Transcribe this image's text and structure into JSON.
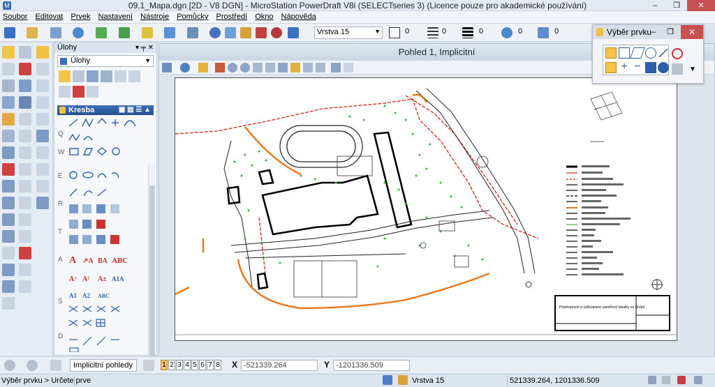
{
  "window": {
    "title": "09.1_Mapa.dgn [2D - V8 DGN] - MicroStation PowerDraft V8i (SELECTseries 3) (Licence pouze pro akademické používání)",
    "minimize": "–",
    "maximize": "❐",
    "close": "✕"
  },
  "menu": [
    "Soubor",
    "Editovat",
    "Prvek",
    "Nastavení",
    "Nástroje",
    "Pomůcky",
    "Prostředí",
    "Okno",
    "Nápověda"
  ],
  "toolbar": {
    "level": "Vrstva 15",
    "color_value": "0",
    "style_value": "0",
    "weight_value": "0",
    "transparency_value": "0",
    "priority_value": "0"
  },
  "tasks_panel": {
    "title": "Úlohy",
    "pin": "▾ ╤ ✕",
    "task_selected": "Úlohy",
    "section_title": "Kresba",
    "row_letters": [
      "Q",
      "W",
      "E",
      "R",
      "T",
      "A",
      "S",
      "D"
    ]
  },
  "view": {
    "title": "Pohled 1, Implicitní"
  },
  "element_selection": {
    "title": "Výběr prvku",
    "minimize": "–",
    "maximize": "❐",
    "close": "✕",
    "menu_arrow": "▼"
  },
  "bottom": {
    "views_combo": "Implicitní pohledy",
    "view_numbers": [
      "1",
      "2",
      "3",
      "4",
      "5",
      "6",
      "7",
      "8"
    ],
    "x_label": "X",
    "x_value": "-521339.264",
    "y_label": "Y",
    "y_value": "-1201336.509"
  },
  "status": {
    "prompt": "Výběr prvku > Určete prve",
    "level": "Vrstva 15",
    "coords": "521339.264, 1201336.509"
  },
  "drawing": {
    "legend_title": "Polohopisné a výškopisné zaměření lokality ve Strání"
  },
  "colors": {
    "accent": "#3d6fb6",
    "orange_line": "#e8761a",
    "red_line": "#d9231b",
    "green_trees": "#3fb33f"
  }
}
